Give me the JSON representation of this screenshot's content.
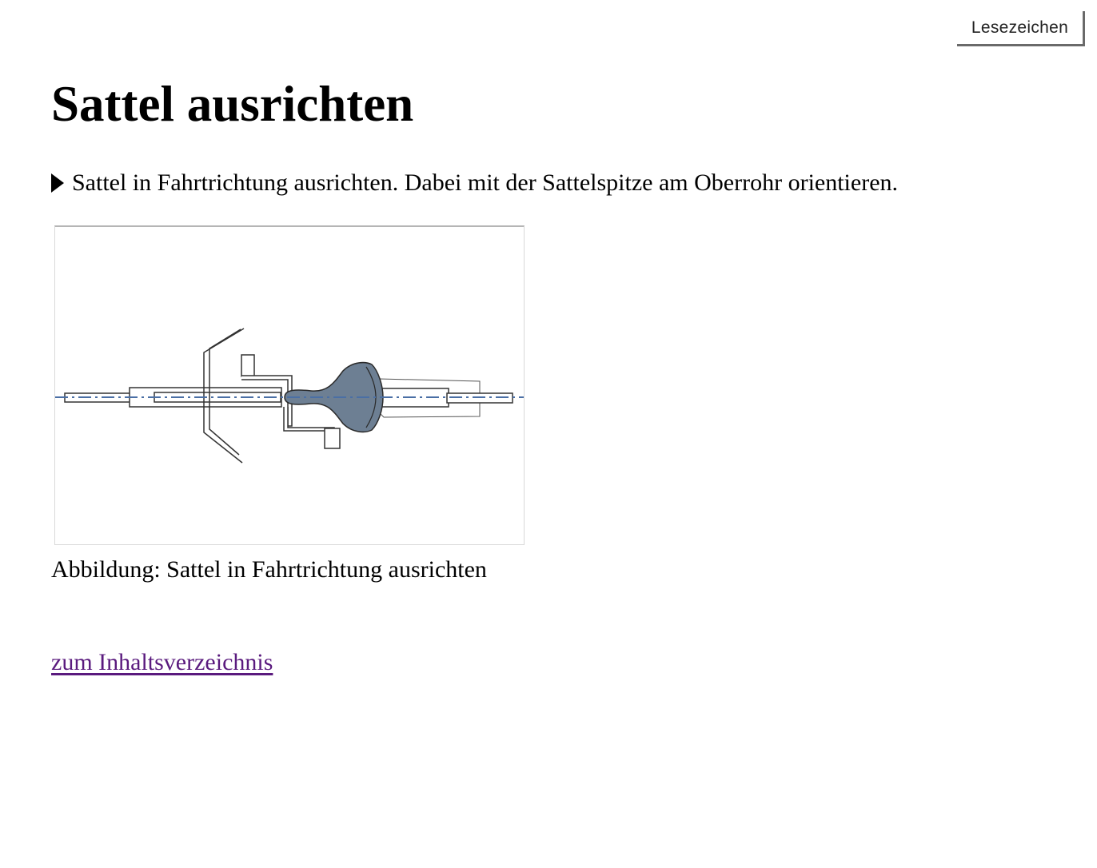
{
  "toolbar": {
    "bookmark_label": "Lesezeichen"
  },
  "page": {
    "title": "Sattel ausrichten",
    "step_text": "Sattel in Fahrtrichtung ausrichten. Dabei mit der Sattelspitze am Oberrohr orientieren.",
    "figure_caption": "Abbildung: Sattel in Fahrtrichtung ausrichten",
    "toc_link": "zum Inhaltsverzeichnis"
  },
  "colors": {
    "saddle_fill": "#6d7f93",
    "center_line": "#4a6fa5",
    "link_visited": "#5a1a7e"
  },
  "icons": {
    "step_marker": "triangle-right-icon"
  }
}
